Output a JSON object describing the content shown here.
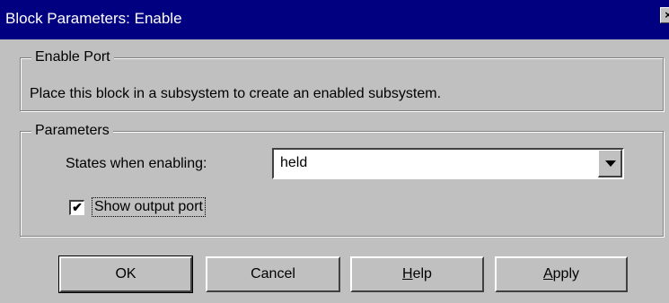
{
  "window": {
    "title": "Block Parameters: Enable",
    "close_glyph": "×"
  },
  "enable_port": {
    "legend": "Enable Port",
    "description": "Place this block in a subsystem to create an enabled subsystem."
  },
  "parameters": {
    "legend": "Parameters",
    "states_label": "States when enabling:",
    "states_value": "held",
    "show_output_label": "Show output port",
    "show_output_checked": true,
    "check_glyph": "✔"
  },
  "buttons": {
    "ok": "OK",
    "cancel": "Cancel",
    "help_mnemonic": "H",
    "help_rest": "elp",
    "apply_mnemonic": "A",
    "apply_rest": "pply"
  }
}
